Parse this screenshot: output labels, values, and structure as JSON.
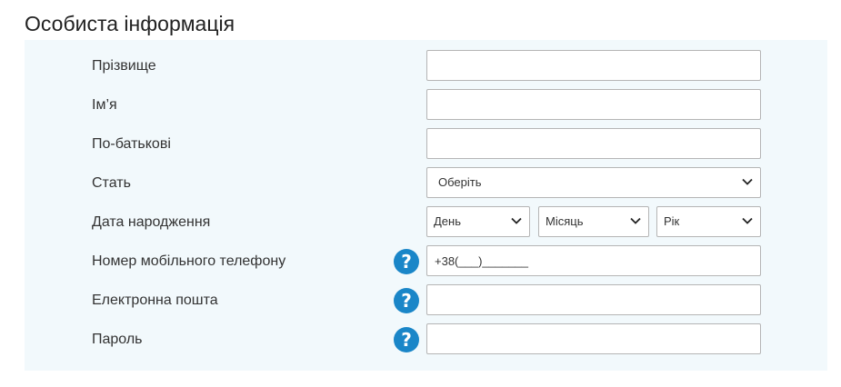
{
  "section": {
    "title": "Особиста інформація"
  },
  "fields": {
    "surname": {
      "label": "Прізвище",
      "value": ""
    },
    "first_name": {
      "label": "Ім’я",
      "value": ""
    },
    "patronymic": {
      "label": "По-батькові",
      "value": ""
    },
    "gender": {
      "label": "Стать",
      "selected": "Оберіть"
    },
    "birth_date": {
      "label": "Дата народження",
      "day": "День",
      "month": "Місяць",
      "year": "Рік"
    },
    "mobile_phone": {
      "label": "Номер мобільного телефону",
      "value": "+38(___)_______",
      "help_icon": "question-mark"
    },
    "email": {
      "label": "Електронна пошта",
      "value": "",
      "help_icon": "question-mark"
    },
    "password": {
      "label": "Пароль",
      "value": "",
      "help_icon": "question-mark"
    }
  },
  "colors": {
    "panel_background": "#f2f9fc",
    "help_icon": "#1a86c8",
    "input_border": "#b5b5b5"
  }
}
